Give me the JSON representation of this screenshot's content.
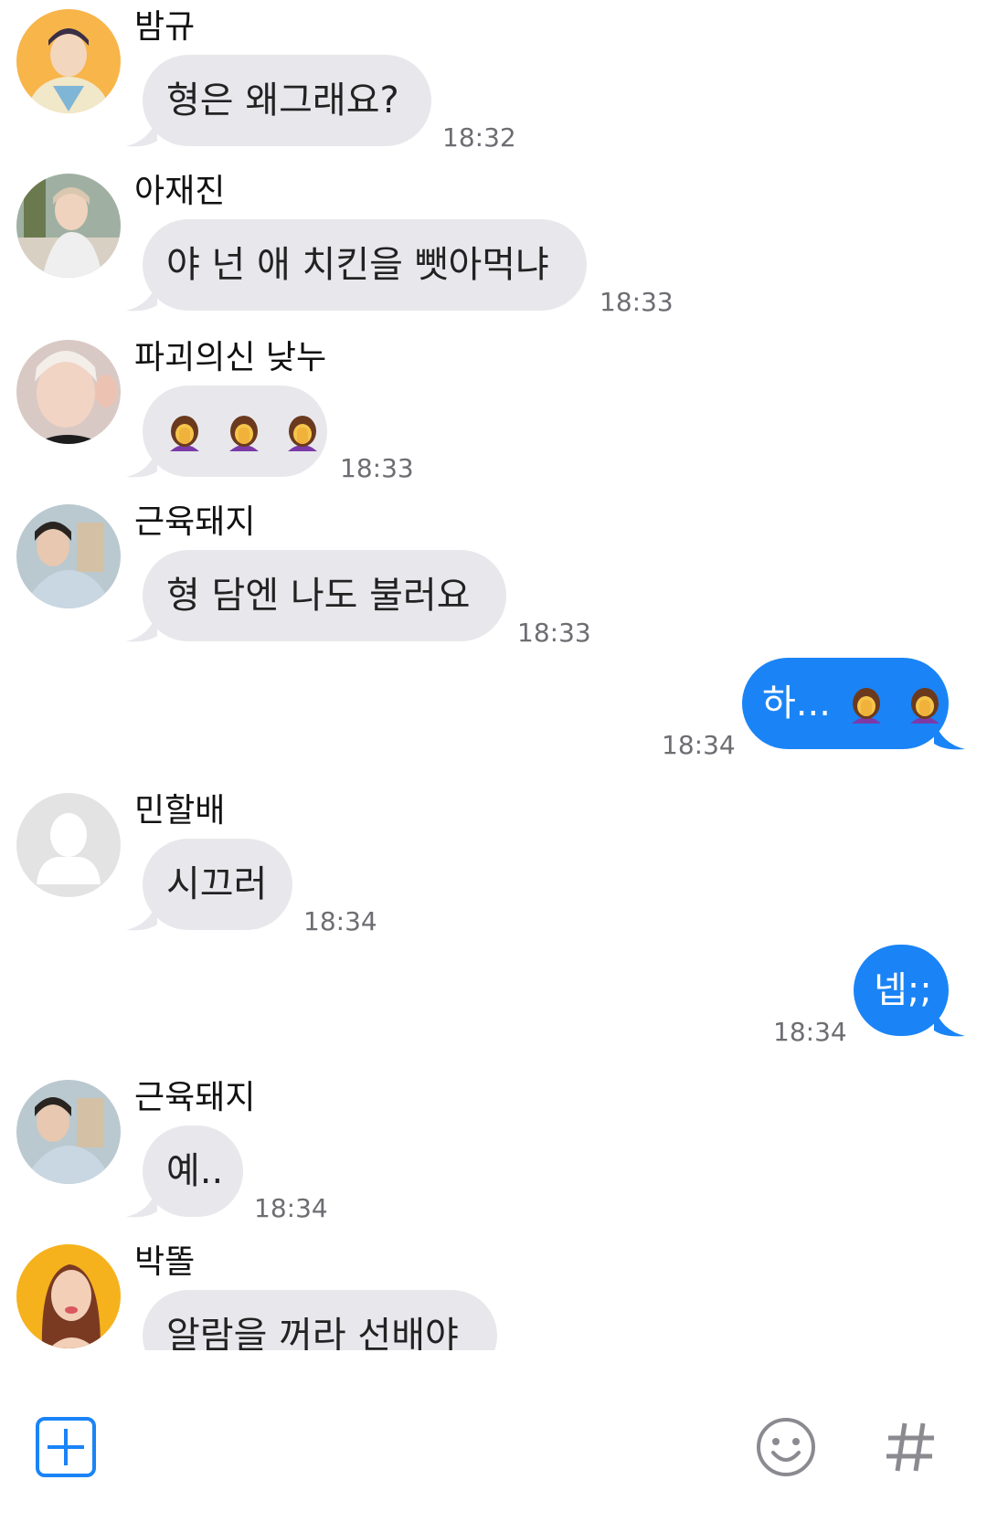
{
  "colors": {
    "incoming_bubble": "#e8e8ec",
    "outgoing_bubble": "#1a84f6",
    "timestamp": "#6d6d72",
    "accent": "#1a84f6"
  },
  "messages": [
    {
      "sender": "밤규",
      "text": "형은 왜그래요?",
      "time": "18:32",
      "avatar": "avatar-photo-icon"
    },
    {
      "sender": "아재진",
      "text": "야 넌 애 치킨을 뺏아먹냐",
      "time": "18:33",
      "avatar": "avatar-photo-icon"
    },
    {
      "sender": "파괴의신 낮누",
      "text": "",
      "emoji": "facepalm-emoji-icon",
      "emoji_count": 3,
      "time": "18:33",
      "avatar": "avatar-photo-icon"
    },
    {
      "sender": "근육돼지",
      "text": "형 담엔 나도 불러요",
      "time": "18:33",
      "avatar": "avatar-photo-icon"
    },
    {
      "outgoing": true,
      "text": "하...",
      "emoji": "facepalm-emoji-icon",
      "emoji_count": 2,
      "time": "18:34"
    },
    {
      "sender": "민할배",
      "text": "시끄러",
      "time": "18:34",
      "avatar": "default-avatar-icon"
    },
    {
      "outgoing": true,
      "text": "넵;;",
      "time": "18:34"
    },
    {
      "sender": "근육돼지",
      "text": "예..",
      "time": "18:34",
      "avatar": "avatar-photo-icon"
    },
    {
      "sender": "박똘",
      "text": "알람을 꺼라 선배야",
      "time": "",
      "avatar": "avatar-photo-icon"
    }
  ],
  "toolbar": {
    "add_icon": "plus-square-icon",
    "emoji_icon": "smiley-icon",
    "hashtag_icon": "hashtag-icon"
  }
}
